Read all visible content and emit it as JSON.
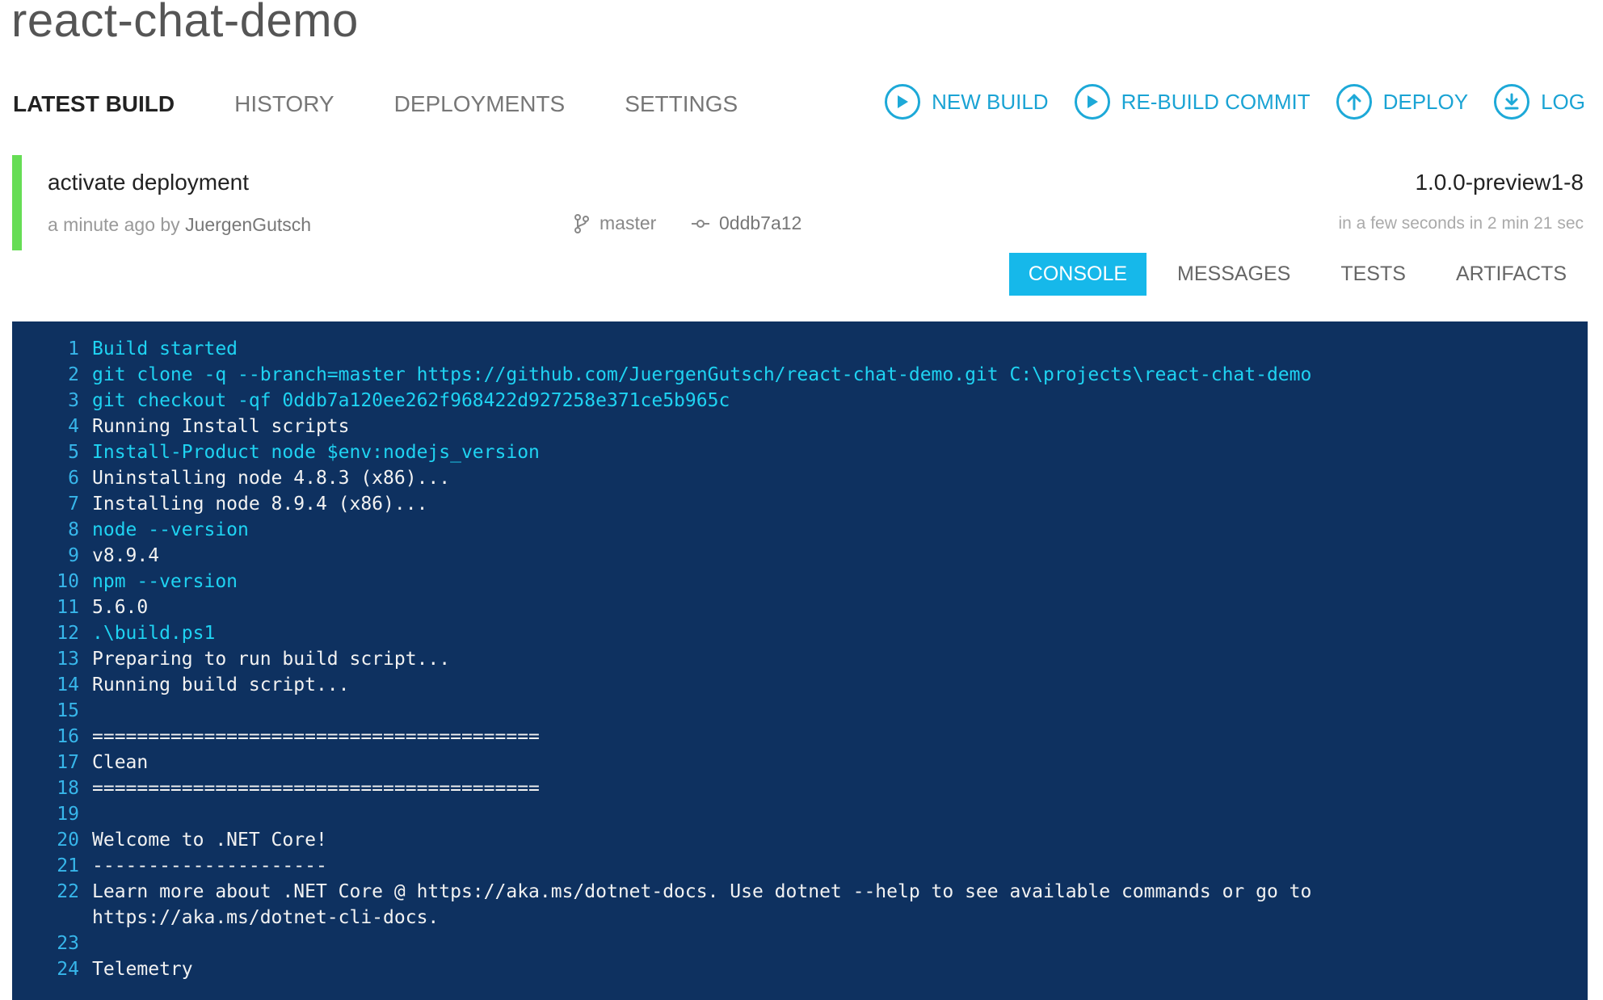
{
  "project": {
    "title": "react-chat-demo"
  },
  "nav": {
    "tabs": [
      {
        "label": "LATEST BUILD",
        "active": true
      },
      {
        "label": "HISTORY",
        "active": false
      },
      {
        "label": "DEPLOYMENTS",
        "active": false
      },
      {
        "label": "SETTINGS",
        "active": false
      }
    ]
  },
  "actions": [
    {
      "label": "NEW BUILD",
      "icon": "play-circle-icon"
    },
    {
      "label": "RE-BUILD COMMIT",
      "icon": "play-circle-icon"
    },
    {
      "label": "DEPLOY",
      "icon": "upload-circle-icon"
    },
    {
      "label": "LOG",
      "icon": "download-circle-icon"
    }
  ],
  "build": {
    "message": "activate deployment",
    "version": "1.0.0-preview1-8",
    "time_by": "a minute ago by",
    "author": "JuergenGutsch",
    "branch": "master",
    "commit": "0ddb7a12",
    "duration": "in a few seconds in 2 min 21 sec",
    "status_color": "#66dd55"
  },
  "subtabs": [
    {
      "label": "CONSOLE",
      "active": true
    },
    {
      "label": "MESSAGES",
      "active": false
    },
    {
      "label": "TESTS",
      "active": false
    },
    {
      "label": "ARTIFACTS",
      "active": false
    }
  ],
  "console": {
    "lines": [
      {
        "n": "1",
        "text": "Build started",
        "type": "cmd"
      },
      {
        "n": "2",
        "text": "git clone -q --branch=master https://github.com/JuergenGutsch/react-chat-demo.git C:\\projects\\react-chat-demo",
        "type": "cmd"
      },
      {
        "n": "3",
        "text": "git checkout -qf 0ddb7a120ee262f968422d927258e371ce5b965c",
        "type": "cmd"
      },
      {
        "n": "4",
        "text": "Running Install scripts",
        "type": "out"
      },
      {
        "n": "5",
        "text": "Install-Product node $env:nodejs_version",
        "type": "cmd"
      },
      {
        "n": "6",
        "text": "Uninstalling node 4.8.3 (x86)...",
        "type": "out"
      },
      {
        "n": "7",
        "text": "Installing node 8.9.4 (x86)...",
        "type": "out"
      },
      {
        "n": "8",
        "text": "node --version",
        "type": "cmd"
      },
      {
        "n": "9",
        "text": "v8.9.4",
        "type": "out"
      },
      {
        "n": "10",
        "text": "npm --version",
        "type": "cmd"
      },
      {
        "n": "11",
        "text": "5.6.0",
        "type": "out"
      },
      {
        "n": "12",
        "text": ".\\build.ps1",
        "type": "cmd"
      },
      {
        "n": "13",
        "text": "Preparing to run build script...",
        "type": "out"
      },
      {
        "n": "14",
        "text": "Running build script...",
        "type": "out"
      },
      {
        "n": "15",
        "text": "",
        "type": "out"
      },
      {
        "n": "16",
        "text": "========================================",
        "type": "out"
      },
      {
        "n": "17",
        "text": "Clean",
        "type": "out"
      },
      {
        "n": "18",
        "text": "========================================",
        "type": "out"
      },
      {
        "n": "19",
        "text": "",
        "type": "out"
      },
      {
        "n": "20",
        "text": "Welcome to .NET Core!",
        "type": "out"
      },
      {
        "n": "21",
        "text": "---------------------",
        "type": "out"
      },
      {
        "n": "22",
        "text": "Learn more about .NET Core @ https://aka.ms/dotnet-docs. Use dotnet --help to see available commands or go to",
        "type": "out"
      },
      {
        "n": "",
        "text": "https://aka.ms/dotnet-cli-docs.",
        "type": "out"
      },
      {
        "n": "23",
        "text": "",
        "type": "out"
      },
      {
        "n": "24",
        "text": "Telemetry",
        "type": "out"
      }
    ]
  }
}
